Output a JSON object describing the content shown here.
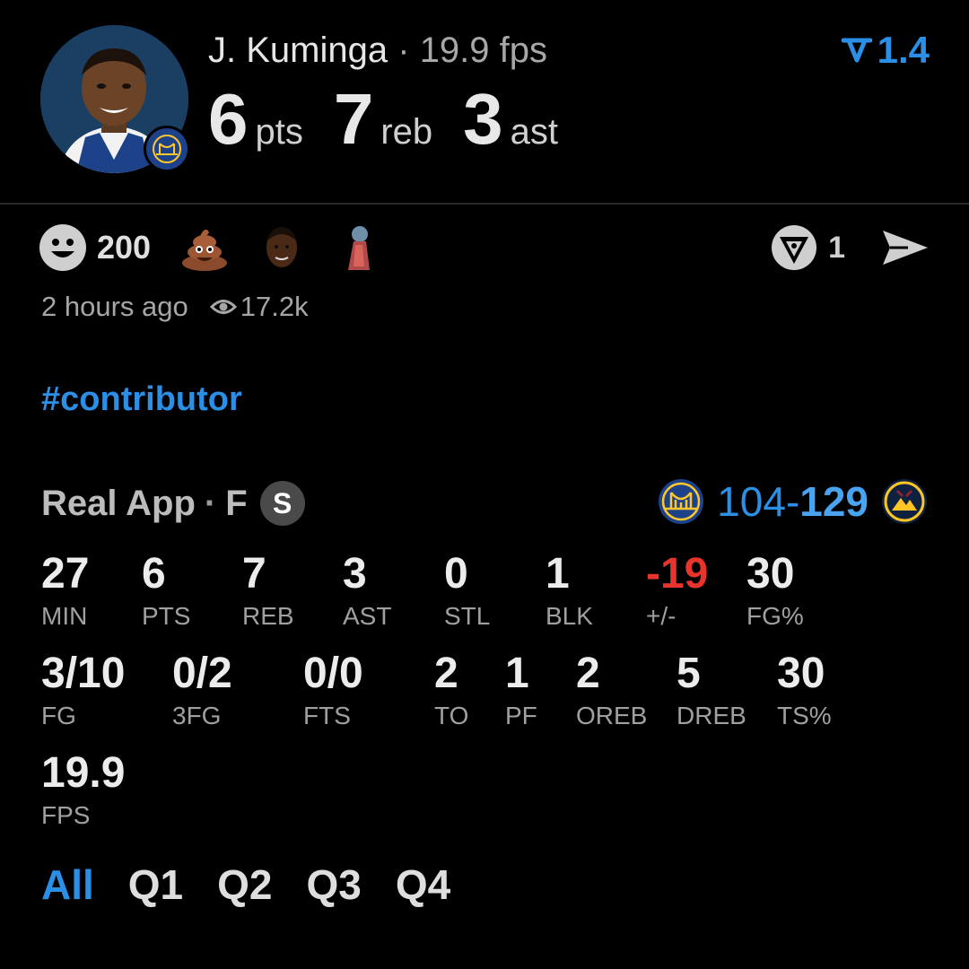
{
  "player": {
    "name": "J. Kuminga",
    "separator": "·",
    "fps_text": "19.9 fps",
    "pts_value": "6",
    "pts_unit": "pts",
    "reb_value": "7",
    "reb_unit": "reb",
    "ast_value": "3",
    "ast_unit": "ast"
  },
  "score_delta": {
    "value": "1.4",
    "icon": "down-arrow-icon",
    "color": "#2b8fe6"
  },
  "reactions": {
    "smiley_count": "200",
    "emojis": [
      "poop-emoji",
      "player-face-emoji",
      "figure-emoji"
    ],
    "alt_count": "1"
  },
  "meta": {
    "time": "2 hours ago",
    "views": "17.2k"
  },
  "hashtag": "#contributor",
  "game": {
    "source": "Real App",
    "separator": "·",
    "status": "F",
    "badge": "S",
    "home_score": "104",
    "dash": "-",
    "away_score": "129",
    "home_team": "warriors-logo",
    "away_team": "nuggets-logo"
  },
  "stats_row1": [
    {
      "value": "27",
      "label": "MIN"
    },
    {
      "value": "6",
      "label": "PTS"
    },
    {
      "value": "7",
      "label": "REB"
    },
    {
      "value": "3",
      "label": "AST"
    },
    {
      "value": "0",
      "label": "STL"
    },
    {
      "value": "1",
      "label": "BLK"
    },
    {
      "value": "-19",
      "label": "+/-"
    },
    {
      "value": "30",
      "label": "FG%"
    }
  ],
  "stats_row2": [
    {
      "value": "3/10",
      "label": "FG"
    },
    {
      "value": "0/2",
      "label": "3FG"
    },
    {
      "value": "0/0",
      "label": "FTS"
    },
    {
      "value": "2",
      "label": "TO"
    },
    {
      "value": "1",
      "label": "PF"
    },
    {
      "value": "2",
      "label": "OREB"
    },
    {
      "value": "5",
      "label": "DREB"
    },
    {
      "value": "30",
      "label": "TS%"
    }
  ],
  "stats_row3": [
    {
      "value": "19.9",
      "label": "FPS"
    }
  ],
  "tabs": [
    "All",
    "Q1",
    "Q2",
    "Q3",
    "Q4"
  ],
  "active_tab": "All",
  "colors": {
    "accent": "#2b8fe6",
    "negative": "#e8342c",
    "background": "#000000"
  }
}
